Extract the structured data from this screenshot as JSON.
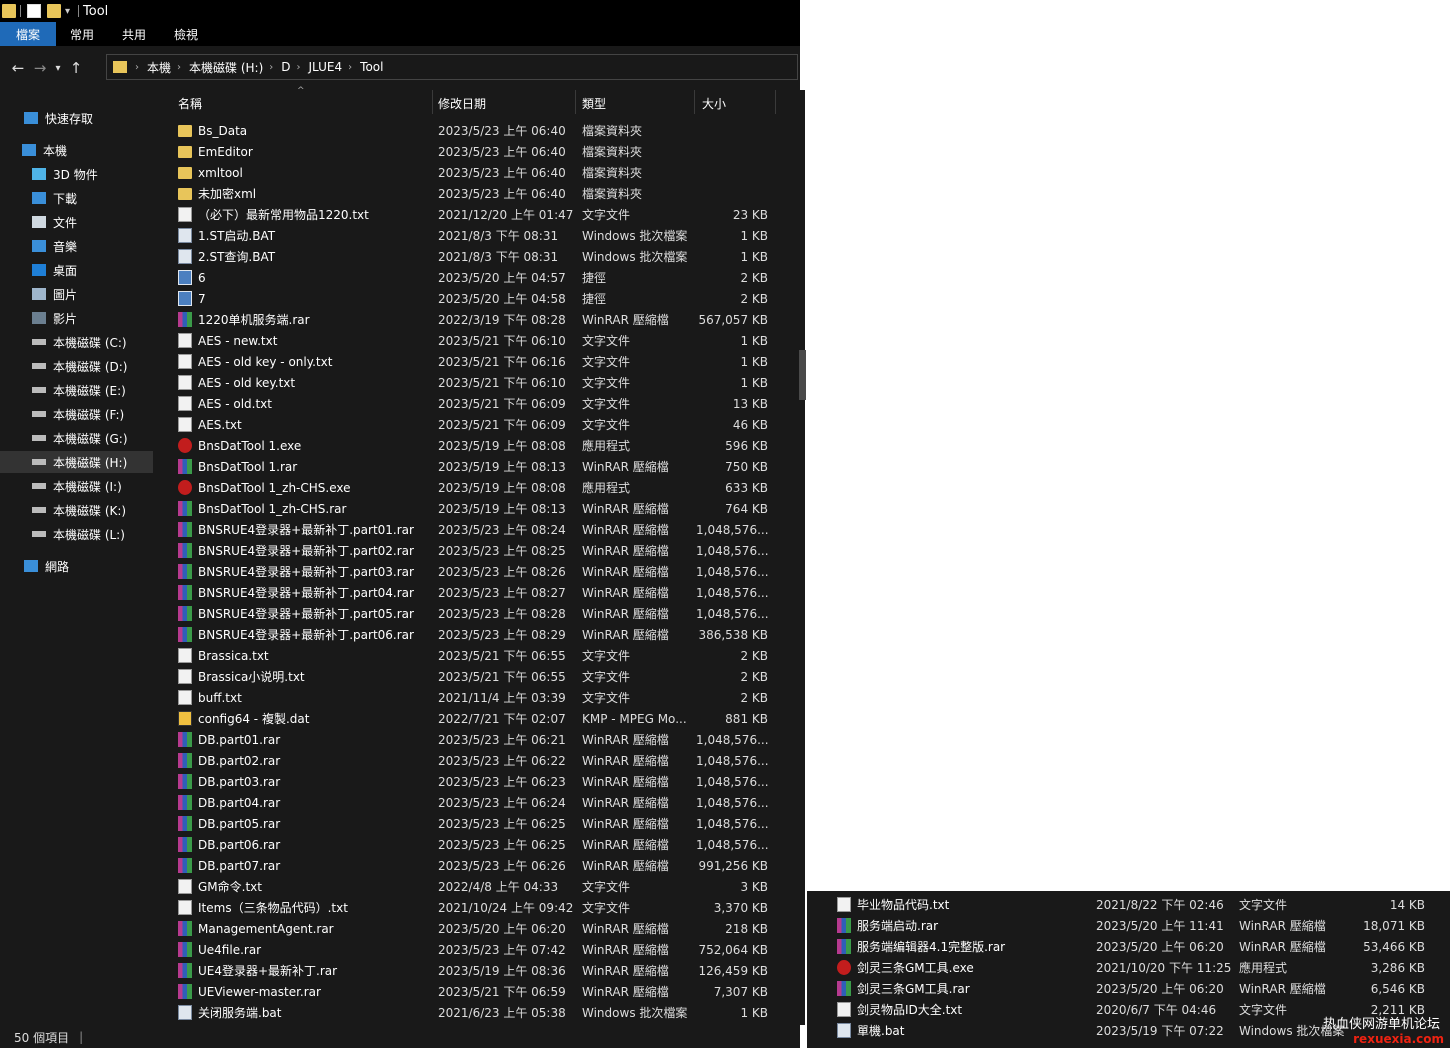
{
  "window": {
    "title": "Tool",
    "ribbon_tabs": [
      "檔案",
      "常用",
      "共用",
      "檢視"
    ],
    "breadcrumb": [
      "本機",
      "本機磁碟 (H:)",
      "D",
      "JLUE4",
      "Tool"
    ],
    "status_text": "50 個項目"
  },
  "columns": {
    "name": "名稱",
    "date": "修改日期",
    "type": "類型",
    "size": "大小"
  },
  "sidebar": {
    "items": [
      {
        "label": "快速存取",
        "icon": "star-icon"
      },
      {
        "label": "本機",
        "icon": "pc-icon"
      },
      {
        "label": "3D 物件",
        "icon": "cube-icon"
      },
      {
        "label": "下載",
        "icon": "download-icon"
      },
      {
        "label": "文件",
        "icon": "document-icon"
      },
      {
        "label": "音樂",
        "icon": "music-icon"
      },
      {
        "label": "桌面",
        "icon": "desktop-icon"
      },
      {
        "label": "圖片",
        "icon": "picture-icon"
      },
      {
        "label": "影片",
        "icon": "video-icon"
      },
      {
        "label": "本機磁碟 (C:)",
        "icon": "drive-icon"
      },
      {
        "label": "本機磁碟 (D:)",
        "icon": "drive-icon"
      },
      {
        "label": "本機磁碟 (E:)",
        "icon": "drive-icon"
      },
      {
        "label": "本機磁碟 (F:)",
        "icon": "drive-icon"
      },
      {
        "label": "本機磁碟 (G:)",
        "icon": "drive-icon"
      },
      {
        "label": "本機磁碟 (H:)",
        "icon": "drive-icon"
      },
      {
        "label": "本機磁碟 (I:)",
        "icon": "drive-icon"
      },
      {
        "label": "本機磁碟 (K:)",
        "icon": "drive-icon"
      },
      {
        "label": "本機磁碟 (L:)",
        "icon": "drive-icon"
      },
      {
        "label": "網路",
        "icon": "network-icon"
      }
    ]
  },
  "files": [
    {
      "name": "Bs_Data",
      "date": "2023/5/23 上午 06:40",
      "type": "檔案資料夾",
      "size": "",
      "icon": "folder"
    },
    {
      "name": "EmEditor",
      "date": "2023/5/23 上午 06:40",
      "type": "檔案資料夾",
      "size": "",
      "icon": "folder"
    },
    {
      "name": "xmltool",
      "date": "2023/5/23 上午 06:40",
      "type": "檔案資料夾",
      "size": "",
      "icon": "folder"
    },
    {
      "name": "未加密xml",
      "date": "2023/5/23 上午 06:40",
      "type": "檔案資料夾",
      "size": "",
      "icon": "folder"
    },
    {
      "name": "（必下）最新常用物品1220.txt",
      "date": "2021/12/20 上午 01:47",
      "type": "文字文件",
      "size": "23 KB",
      "icon": "txt"
    },
    {
      "name": "1.ST启动.BAT",
      "date": "2021/8/3 下午 08:31",
      "type": "Windows 批次檔案",
      "size": "1 KB",
      "icon": "bat"
    },
    {
      "name": "2.ST查询.BAT",
      "date": "2021/8/3 下午 08:31",
      "type": "Windows 批次檔案",
      "size": "1 KB",
      "icon": "bat"
    },
    {
      "name": "6",
      "date": "2023/5/20 上午 04:57",
      "type": "捷徑",
      "size": "2 KB",
      "icon": "lnk"
    },
    {
      "name": "7",
      "date": "2023/5/20 上午 04:58",
      "type": "捷徑",
      "size": "2 KB",
      "icon": "lnk"
    },
    {
      "name": "1220单机服务端.rar",
      "date": "2022/3/19 下午 08:28",
      "type": "WinRAR 壓縮檔",
      "size": "567,057 KB",
      "icon": "rar"
    },
    {
      "name": "AES - new.txt",
      "date": "2023/5/21 下午 06:10",
      "type": "文字文件",
      "size": "1 KB",
      "icon": "txt"
    },
    {
      "name": "AES - old key - only.txt",
      "date": "2023/5/21 下午 06:16",
      "type": "文字文件",
      "size": "1 KB",
      "icon": "txt"
    },
    {
      "name": "AES - old key.txt",
      "date": "2023/5/21 下午 06:10",
      "type": "文字文件",
      "size": "1 KB",
      "icon": "txt"
    },
    {
      "name": "AES - old.txt",
      "date": "2023/5/21 下午 06:09",
      "type": "文字文件",
      "size": "13 KB",
      "icon": "txt"
    },
    {
      "name": "AES.txt",
      "date": "2023/5/21 下午 06:09",
      "type": "文字文件",
      "size": "46 KB",
      "icon": "txt"
    },
    {
      "name": "BnsDatTool 1.exe",
      "date": "2023/5/19 上午 08:08",
      "type": "應用程式",
      "size": "596 KB",
      "icon": "exe"
    },
    {
      "name": "BnsDatTool 1.rar",
      "date": "2023/5/19 上午 08:13",
      "type": "WinRAR 壓縮檔",
      "size": "750 KB",
      "icon": "rar"
    },
    {
      "name": "BnsDatTool 1_zh-CHS.exe",
      "date": "2023/5/19 上午 08:08",
      "type": "應用程式",
      "size": "633 KB",
      "icon": "exe"
    },
    {
      "name": "BnsDatTool 1_zh-CHS.rar",
      "date": "2023/5/19 上午 08:13",
      "type": "WinRAR 壓縮檔",
      "size": "764 KB",
      "icon": "rar"
    },
    {
      "name": "BNSRUE4登录器+最新补丁.part01.rar",
      "date": "2023/5/23 上午 08:24",
      "type": "WinRAR 壓縮檔",
      "size": "1,048,576...",
      "icon": "rar"
    },
    {
      "name": "BNSRUE4登录器+最新补丁.part02.rar",
      "date": "2023/5/23 上午 08:25",
      "type": "WinRAR 壓縮檔",
      "size": "1,048,576...",
      "icon": "rar"
    },
    {
      "name": "BNSRUE4登录器+最新补丁.part03.rar",
      "date": "2023/5/23 上午 08:26",
      "type": "WinRAR 壓縮檔",
      "size": "1,048,576...",
      "icon": "rar"
    },
    {
      "name": "BNSRUE4登录器+最新补丁.part04.rar",
      "date": "2023/5/23 上午 08:27",
      "type": "WinRAR 壓縮檔",
      "size": "1,048,576...",
      "icon": "rar"
    },
    {
      "name": "BNSRUE4登录器+最新补丁.part05.rar",
      "date": "2023/5/23 上午 08:28",
      "type": "WinRAR 壓縮檔",
      "size": "1,048,576...",
      "icon": "rar"
    },
    {
      "name": "BNSRUE4登录器+最新补丁.part06.rar",
      "date": "2023/5/23 上午 08:29",
      "type": "WinRAR 壓縮檔",
      "size": "386,538 KB",
      "icon": "rar"
    },
    {
      "name": "Brassica.txt",
      "date": "2023/5/21 下午 06:55",
      "type": "文字文件",
      "size": "2 KB",
      "icon": "txt"
    },
    {
      "name": "Brassica小说明.txt",
      "date": "2023/5/21 下午 06:55",
      "type": "文字文件",
      "size": "2 KB",
      "icon": "txt"
    },
    {
      "name": "buff.txt",
      "date": "2021/11/4 上午 03:39",
      "type": "文字文件",
      "size": "2 KB",
      "icon": "txt"
    },
    {
      "name": "config64 - 複製.dat",
      "date": "2022/7/21 下午 02:07",
      "type": "KMP - MPEG Mo...",
      "size": "881 KB",
      "icon": "dat"
    },
    {
      "name": "DB.part01.rar",
      "date": "2023/5/23 上午 06:21",
      "type": "WinRAR 壓縮檔",
      "size": "1,048,576...",
      "icon": "rar"
    },
    {
      "name": "DB.part02.rar",
      "date": "2023/5/23 上午 06:22",
      "type": "WinRAR 壓縮檔",
      "size": "1,048,576...",
      "icon": "rar"
    },
    {
      "name": "DB.part03.rar",
      "date": "2023/5/23 上午 06:23",
      "type": "WinRAR 壓縮檔",
      "size": "1,048,576...",
      "icon": "rar"
    },
    {
      "name": "DB.part04.rar",
      "date": "2023/5/23 上午 06:24",
      "type": "WinRAR 壓縮檔",
      "size": "1,048,576...",
      "icon": "rar"
    },
    {
      "name": "DB.part05.rar",
      "date": "2023/5/23 上午 06:25",
      "type": "WinRAR 壓縮檔",
      "size": "1,048,576...",
      "icon": "rar"
    },
    {
      "name": "DB.part06.rar",
      "date": "2023/5/23 上午 06:25",
      "type": "WinRAR 壓縮檔",
      "size": "1,048,576...",
      "icon": "rar"
    },
    {
      "name": "DB.part07.rar",
      "date": "2023/5/23 上午 06:26",
      "type": "WinRAR 壓縮檔",
      "size": "991,256 KB",
      "icon": "rar"
    },
    {
      "name": "GM命令.txt",
      "date": "2022/4/8 上午 04:33",
      "type": "文字文件",
      "size": "3 KB",
      "icon": "txt"
    },
    {
      "name": "Items（三条物品代码）.txt",
      "date": "2021/10/24 上午 09:42",
      "type": "文字文件",
      "size": "3,370 KB",
      "icon": "txt"
    },
    {
      "name": "ManagementAgent.rar",
      "date": "2023/5/20 上午 06:20",
      "type": "WinRAR 壓縮檔",
      "size": "218 KB",
      "icon": "rar"
    },
    {
      "name": "Ue4file.rar",
      "date": "2023/5/23 上午 07:42",
      "type": "WinRAR 壓縮檔",
      "size": "752,064 KB",
      "icon": "rar"
    },
    {
      "name": "UE4登录器+最新补丁.rar",
      "date": "2023/5/19 上午 08:36",
      "type": "WinRAR 壓縮檔",
      "size": "126,459 KB",
      "icon": "rar"
    },
    {
      "name": "UEViewer-master.rar",
      "date": "2023/5/21 下午 06:59",
      "type": "WinRAR 壓縮檔",
      "size": "7,307 KB",
      "icon": "rar"
    },
    {
      "name": "关闭服务端.bat",
      "date": "2021/6/23 上午 05:38",
      "type": "Windows 批次檔案",
      "size": "1 KB",
      "icon": "bat"
    }
  ],
  "files2": [
    {
      "name": "毕业物品代码.txt",
      "date": "2021/8/22 下午 02:46",
      "type": "文字文件",
      "size": "14 KB",
      "icon": "txt"
    },
    {
      "name": "服务端启动.rar",
      "date": "2023/5/20 上午 11:41",
      "type": "WinRAR 壓縮檔",
      "size": "18,071 KB",
      "icon": "rar"
    },
    {
      "name": "服务端编辑器4.1完整版.rar",
      "date": "2023/5/20 上午 06:20",
      "type": "WinRAR 壓縮檔",
      "size": "53,466 KB",
      "icon": "rar"
    },
    {
      "name": "剑灵三条GM工具.exe",
      "date": "2021/10/20 下午 11:25",
      "type": "應用程式",
      "size": "3,286 KB",
      "icon": "exe"
    },
    {
      "name": "剑灵三条GM工具.rar",
      "date": "2023/5/20 上午 06:20",
      "type": "WinRAR 壓縮檔",
      "size": "6,546 KB",
      "icon": "rar"
    },
    {
      "name": "剑灵物品ID大全.txt",
      "date": "2020/6/7 下午 04:46",
      "type": "文字文件",
      "size": "2,211 KB",
      "icon": "txt"
    },
    {
      "name": "單機.bat",
      "date": "2023/5/19 下午 07:22",
      "type": "Windows 批次檔案",
      "size": "",
      "icon": "bat"
    }
  ],
  "watermark": {
    "line1": "热血侠网游单机论坛",
    "line2": "rexuexia.com"
  }
}
